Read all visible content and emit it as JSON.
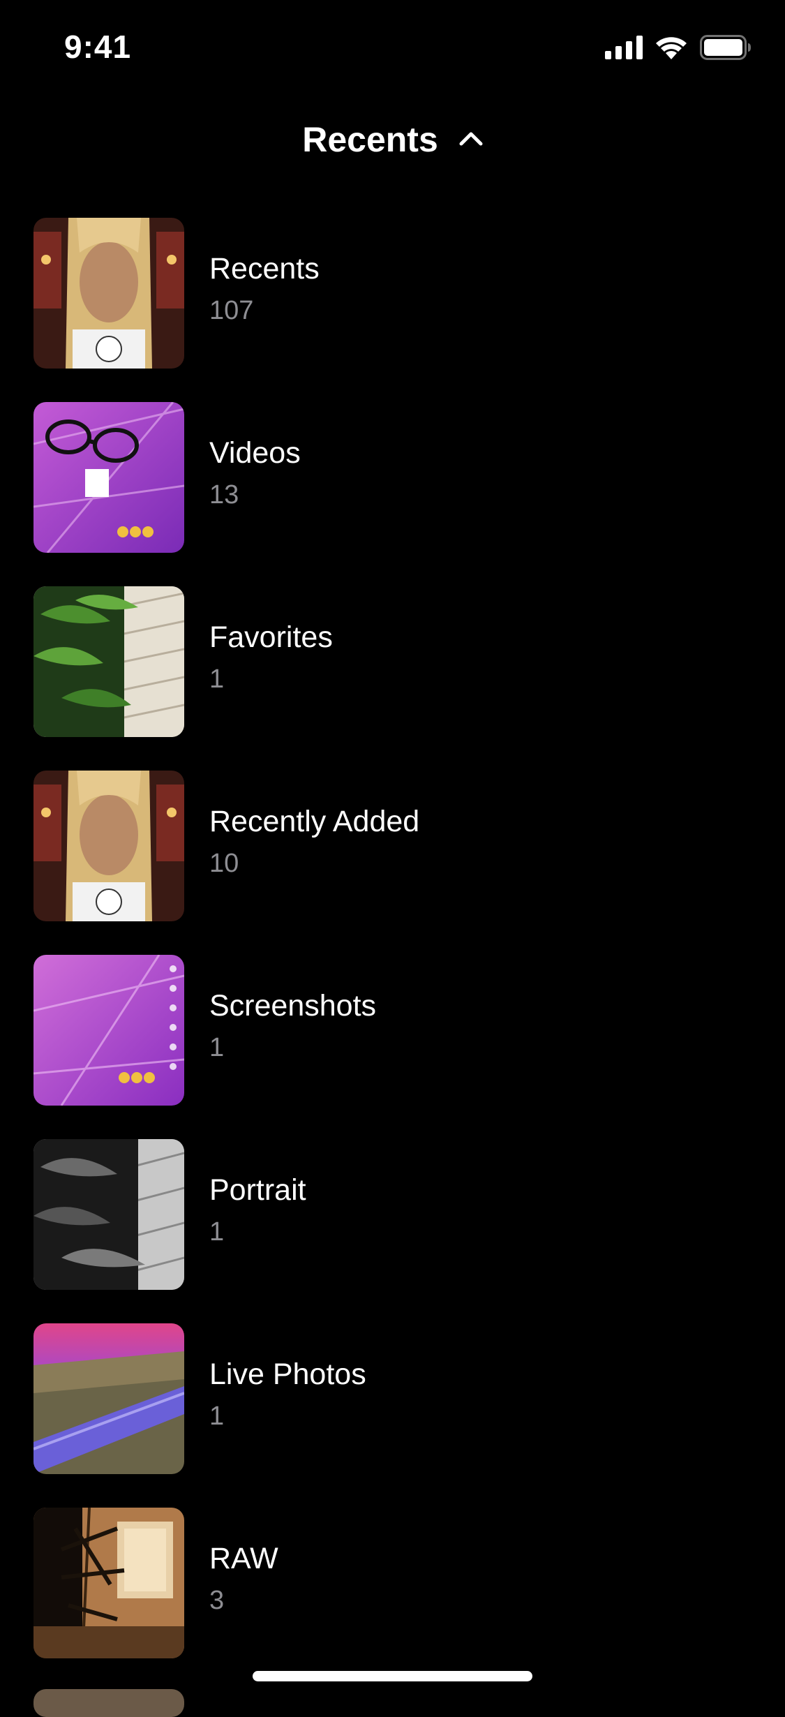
{
  "status_bar": {
    "time": "9:41",
    "icons": [
      "cellular-signal-icon",
      "wifi-icon",
      "battery-icon"
    ]
  },
  "header": {
    "title": "Recents",
    "icon": "chevron-up-icon"
  },
  "albums": [
    {
      "name": "Recents",
      "count": "107",
      "thumb": "portrait-blonde-wig"
    },
    {
      "name": "Videos",
      "count": "13",
      "thumb": "purple-glasses-filter"
    },
    {
      "name": "Favorites",
      "count": "1",
      "thumb": "green-plant-brick-wall"
    },
    {
      "name": "Recently Added",
      "count": "10",
      "thumb": "portrait-blonde-wig"
    },
    {
      "name": "Screenshots",
      "count": "1",
      "thumb": "purple-filter-screenshot"
    },
    {
      "name": "Portrait",
      "count": "1",
      "thumb": "black-white-plant"
    },
    {
      "name": "Live Photos",
      "count": "1",
      "thumb": "pink-sky-guardrail"
    },
    {
      "name": "RAW",
      "count": "3",
      "thumb": "palm-window"
    }
  ],
  "colors": {
    "background": "#000000",
    "text_primary": "#ffffff",
    "text_secondary": "#8e8e93"
  }
}
